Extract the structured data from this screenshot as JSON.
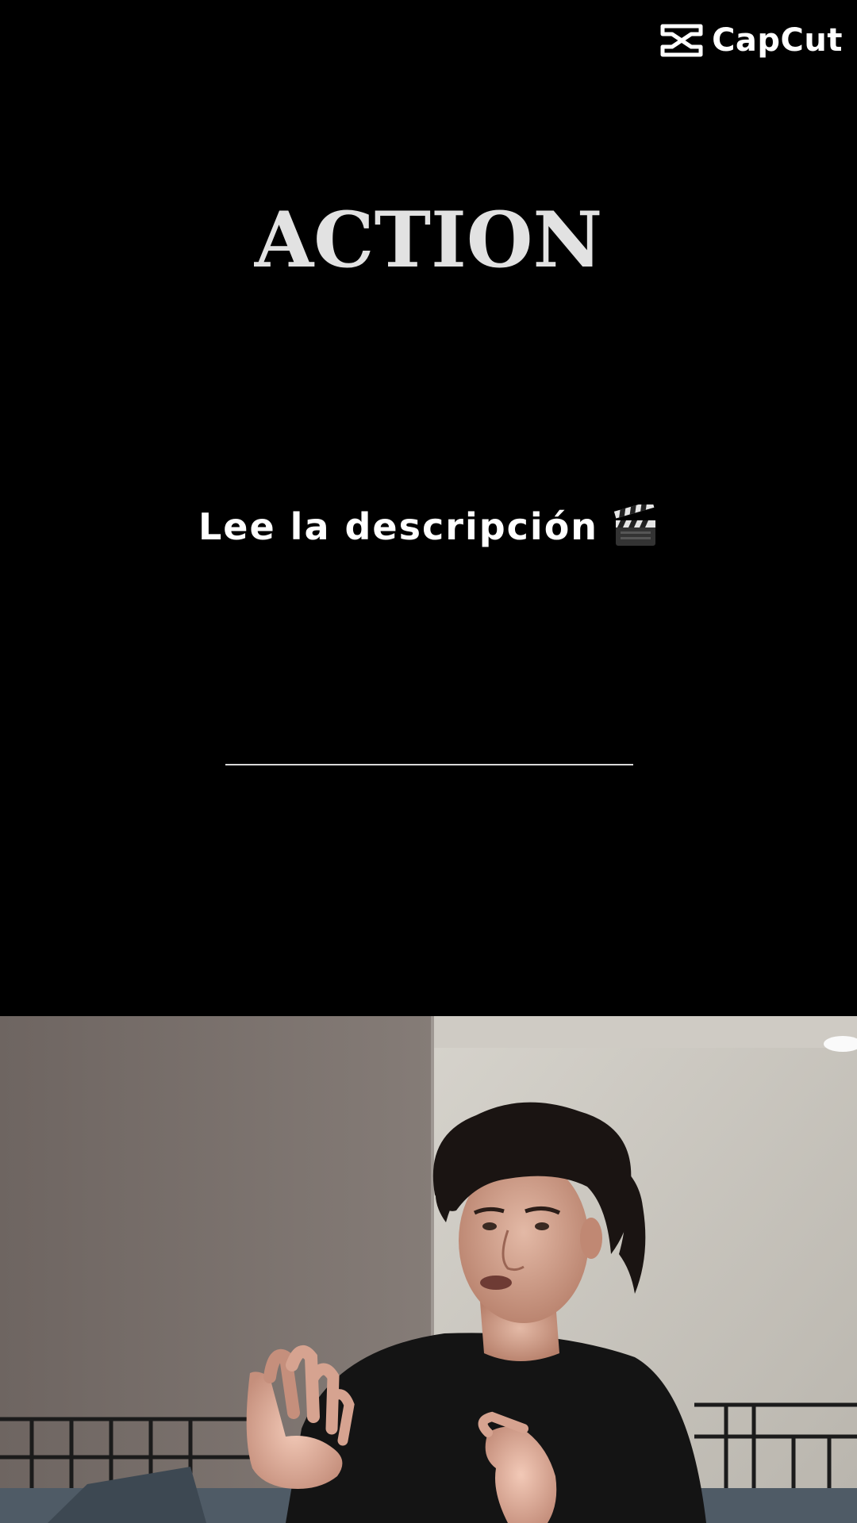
{
  "watermark": {
    "brand": "CapCut",
    "icon": "capcut-logo-icon"
  },
  "title": "ACTION",
  "caption": {
    "text": "Lee la descripción",
    "icon": "clapperboard-icon"
  },
  "video": {
    "description_icon": "video-frame"
  },
  "colors": {
    "background": "#000000",
    "title": "#e2e2e2",
    "caption": "#ffffff",
    "divider": "#d8d8d8"
  }
}
